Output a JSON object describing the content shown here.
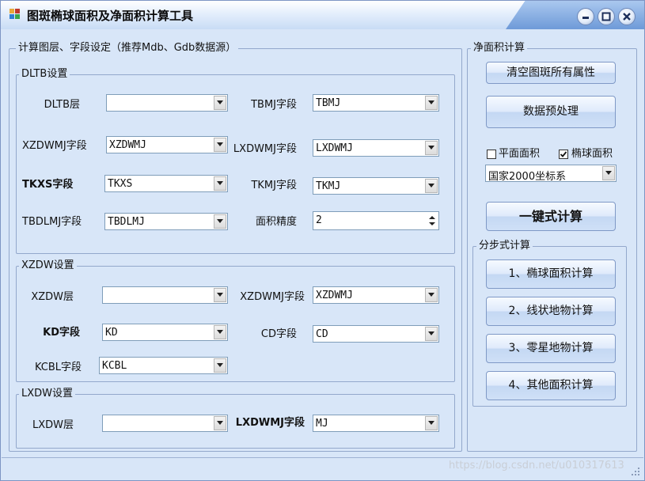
{
  "window": {
    "title": "图斑椭球面积及净面积计算工具"
  },
  "calc_group": {
    "title": "计算图层、字段设定（推荐Mdb、Gdb数据源）",
    "dltb": {
      "title": "DLTB设置",
      "dltb_layer_label": "DLTB层",
      "dltb_layer_value": "",
      "tbmj_label": "TBMJ字段",
      "tbmj_value": "TBMJ",
      "xzdwmj_label": "XZDWMJ字段",
      "xzdwmj_value": "XZDWMJ",
      "lxdwmj_label": "LXDWMJ字段",
      "lxdwmj_value": "LXDWMJ",
      "tkxs_label": "TKXS字段",
      "tkxs_value": "TKXS",
      "tkmj_label": "TKMJ字段",
      "tkmj_value": "TKMJ",
      "tbdlmj_label": "TBDLMJ字段",
      "tbdlmj_value": "TBDLMJ",
      "precision_label": "面积精度",
      "precision_value": "2"
    },
    "xzdw": {
      "title": "XZDW设置",
      "layer_label": "XZDW层",
      "layer_value": "",
      "xzdwmj_label": "XZDWMJ字段",
      "xzdwmj_value": "XZDWMJ",
      "kd_label": "KD字段",
      "kd_value": "KD",
      "cd_label": "CD字段",
      "cd_value": "CD",
      "kcbl_label": "KCBL字段",
      "kcbl_value": "KCBL"
    },
    "lxdw": {
      "title": "LXDW设置",
      "layer_label": "LXDW层",
      "layer_value": "",
      "lxdwmj_label": "LXDWMJ字段",
      "lxdwmj_value": "MJ"
    }
  },
  "net_group": {
    "title": "净面积计算",
    "clear_button": "清空图斑所有属性",
    "preprocess_button": "数据预处理",
    "plane_area_label": "平面面积",
    "plane_area_checked": false,
    "ellipsoid_area_label": "椭球面积",
    "ellipsoid_area_checked": true,
    "coord_system": "国家2000坐标系",
    "one_click_button": "一键式计算",
    "step_group": {
      "title": "分步式计算",
      "step1": "1、椭球面积计算",
      "step2": "2、线状地物计算",
      "step3": "3、零星地物计算",
      "step4": "4、其他面积计算"
    }
  },
  "watermark": "https://blog.csdn.net/u010317613",
  "icons": [
    "app-icon",
    "minimize-icon",
    "restore-icon",
    "close-icon",
    "dropdown-arrow-icon",
    "spin-arrows-icon",
    "size-grip-icon"
  ]
}
